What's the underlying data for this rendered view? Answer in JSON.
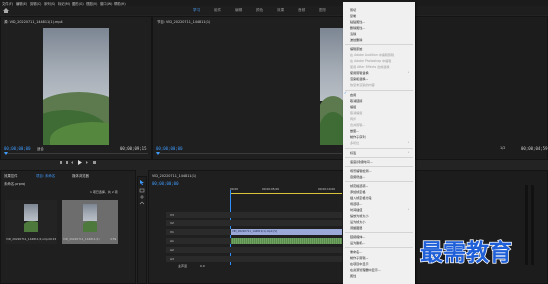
{
  "menu": [
    "文件(F)",
    "编辑(E)",
    "剪辑(C)",
    "序列(S)",
    "标记(M)",
    "图形(G)",
    "视图(V)",
    "窗口(W)",
    "帮助(H)"
  ],
  "workspaces": [
    "学习",
    "组件",
    "编辑",
    "颜色",
    "效果",
    "音频",
    "图形",
    "库"
  ],
  "source_monitor": {
    "title": "源: VID_20220711_144811(1).mp4",
    "timecode": "00;00;00;00",
    "duration": "00;00;09;15",
    "fit": "适合"
  },
  "program_monitor": {
    "title": "节目: VID_20220711_144811(1)",
    "timecode": "00;00;00;00",
    "duration": "00;00;04;59",
    "fit": "1/2"
  },
  "project": {
    "tab_effects": "效果控件",
    "tab_audio": "音频剪辑混合器",
    "tab_project": "项目: 未命名",
    "tab_media": "媒体浏览器",
    "path": "未命名.prproj",
    "count": "1 项已选择，共 2 项",
    "items": [
      {
        "name": "VID_20220711_144811(1).mp4",
        "dur": "9;15"
      },
      {
        "name": "VID_20220711_144811(1)",
        "dur": "4;59"
      }
    ]
  },
  "timeline": {
    "title": "VID_20220711_144811(1)",
    "timecode": "00;00;00;00",
    "ruler": [
      "00;00",
      "00;00;05;00",
      "00;00;10;00"
    ],
    "video_tracks": [
      "V3",
      "V2",
      "V1"
    ],
    "audio_tracks": [
      "A1",
      "A2",
      "A3"
    ],
    "master": "主声道",
    "master_val": "0.0",
    "clip": "VID_20220711_144811(1).mp4 [V]"
  },
  "context_menu": {
    "items": [
      {
        "label": "剪切",
        "disabled": false
      },
      {
        "label": "复制",
        "disabled": false
      },
      {
        "label": "粘贴属性...",
        "disabled": false
      },
      {
        "label": "删除属性...",
        "disabled": false
      },
      {
        "label": "清除",
        "disabled": false
      },
      {
        "label": "波纹删除",
        "disabled": false
      },
      {
        "label": "编辑原始",
        "disabled": false
      },
      {
        "label": "在 Adobe Audition 中编辑剪辑",
        "disabled": true
      },
      {
        "label": "在 Adobe Photoshop 中编辑",
        "disabled": true
      },
      {
        "label": "使用 After Effects 合成替换",
        "disabled": true
      },
      {
        "label": "使用剪辑替换",
        "disabled": false
      },
      {
        "label": "渲染和替换...",
        "disabled": false
      },
      {
        "label": "恢复未渲染的内容",
        "disabled": true
      },
      {
        "label": "启用",
        "disabled": false,
        "checked": true
      },
      {
        "label": "取消链接",
        "disabled": false
      },
      {
        "label": "编组",
        "disabled": false
      },
      {
        "label": "取消编组",
        "disabled": true
      },
      {
        "label": "同步",
        "disabled": true
      },
      {
        "label": "合并剪辑...",
        "disabled": true
      },
      {
        "label": "嵌套...",
        "disabled": false
      },
      {
        "label": "制作子序列",
        "disabled": false
      },
      {
        "label": "多机位",
        "disabled": true
      },
      {
        "label": "标签",
        "disabled": false
      },
      {
        "label": "速度/持续时间...",
        "disabled": false
      },
      {
        "label": "场景编辑检测...",
        "disabled": false
      },
      {
        "label": "音频增益...",
        "disabled": false
      },
      {
        "label": "帧定格选项...",
        "disabled": false
      },
      {
        "label": "添加帧定格",
        "disabled": false
      },
      {
        "label": "插入帧定格分段",
        "disabled": false
      },
      {
        "label": "场选项...",
        "disabled": false
      },
      {
        "label": "时间插值",
        "disabled": false
      },
      {
        "label": "缩放为帧大小",
        "disabled": false
      },
      {
        "label": "设为帧大小",
        "disabled": false
      },
      {
        "label": "调整图层",
        "disabled": false
      },
      {
        "label": "链接媒体...",
        "disabled": false
      },
      {
        "label": "设为脱机...",
        "disabled": false
      },
      {
        "label": "重命名...",
        "disabled": false
      },
      {
        "label": "制作子剪辑...",
        "disabled": false
      },
      {
        "label": "在项目中显示",
        "disabled": false
      },
      {
        "label": "在资源管理器中显示...",
        "disabled": false
      },
      {
        "label": "属性",
        "disabled": false
      }
    ]
  },
  "watermark": "最需教育",
  "colors": {
    "accent": "#3f9cff",
    "playhead": "#2f8fff",
    "clip_video": "#9aa9d8",
    "menu_bg": "#f0f0f0"
  }
}
